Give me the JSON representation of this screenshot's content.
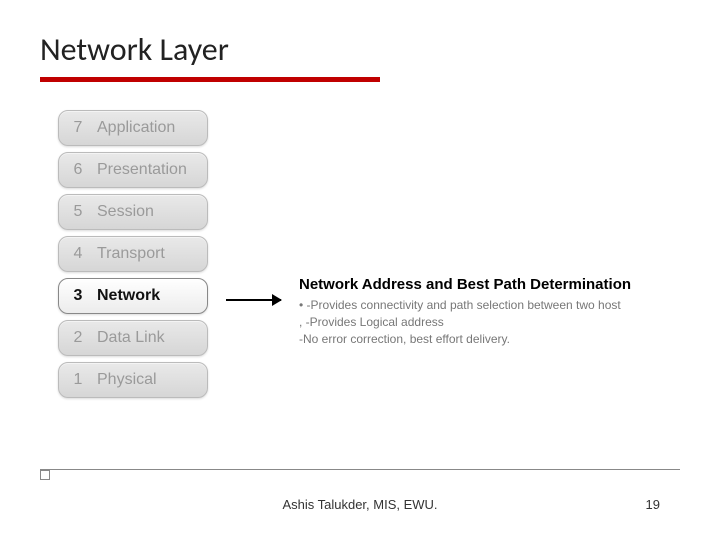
{
  "title": "Network Layer",
  "layers": [
    {
      "num": "7",
      "name": "Application",
      "active": false
    },
    {
      "num": "6",
      "name": "Presentation",
      "active": false
    },
    {
      "num": "5",
      "name": "Session",
      "active": false
    },
    {
      "num": "4",
      "name": "Transport",
      "active": false
    },
    {
      "num": "3",
      "name": "Network",
      "active": true
    },
    {
      "num": "2",
      "name": "Data Link",
      "active": false
    },
    {
      "num": "1",
      "name": "Physical",
      "active": false
    }
  ],
  "detail": {
    "heading": "Network Address and Best Path Determination",
    "line1": "• -Provides connectivity and path selection between two host",
    "line2": ", -Provides Logical address",
    "line3": " -No error correction, best effort delivery."
  },
  "footer": {
    "author": "Ashis Talukder, MIS, EWU.",
    "page": "19"
  }
}
